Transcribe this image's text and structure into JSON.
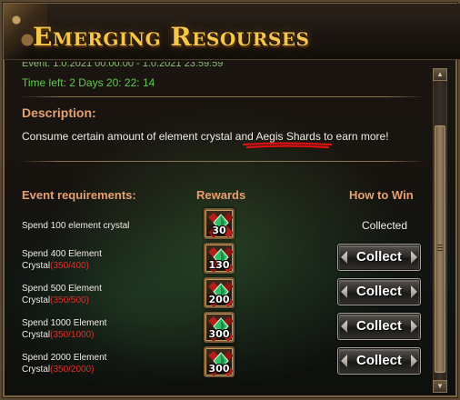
{
  "window": {
    "title": "Emerging Resourses"
  },
  "event": {
    "partial_line": "Event: 1.0.2021 00:00:00 - 1.0.2021 23:59:59",
    "time_left": "Time left: 2 Days  20: 22: 14",
    "description_heading": "Description:",
    "description_text": "Consume certain amount of element crystal and Aegis Shards to earn more!"
  },
  "table": {
    "headers": {
      "requirements": "Event requirements:",
      "rewards": "Rewards",
      "how_to_win": "How to Win"
    },
    "rows": [
      {
        "line1": "Spend 100 element crystal",
        "line2": "",
        "progress": "",
        "reward_icon": "element-crystal-chest-icon",
        "reward_count": "30",
        "status": "Collected"
      },
      {
        "line1": "Spend 400 Element",
        "line2": "Crystal",
        "progress": "(350/400)",
        "reward_icon": "element-crystal-chest-icon",
        "reward_count": "130",
        "action": "Collect"
      },
      {
        "line1": "Spend 500 Element",
        "line2": "Crystal",
        "progress": "(350/500)",
        "reward_icon": "element-crystal-chest-icon",
        "reward_count": "200",
        "action": "Collect"
      },
      {
        "line1": "Spend 1000 Element",
        "line2": "Crystal",
        "progress": "(350/1000)",
        "reward_icon": "element-crystal-chest-icon",
        "reward_count": "300",
        "action": "Collect"
      },
      {
        "line1": "Spend 2000 Element",
        "line2": "Crystal",
        "progress": "(350/2000)",
        "reward_icon": "element-crystal-chest-icon",
        "reward_count": "300",
        "action": "Collect"
      }
    ]
  },
  "colors": {
    "title_gold": "#f5c64a",
    "heading_orange": "#e8a070",
    "time_green": "#62c94f",
    "progress_red": "#e0302a",
    "annotation_red": "#e01010"
  },
  "icons": {
    "scroll_up": "▲",
    "scroll_down": "▼"
  }
}
